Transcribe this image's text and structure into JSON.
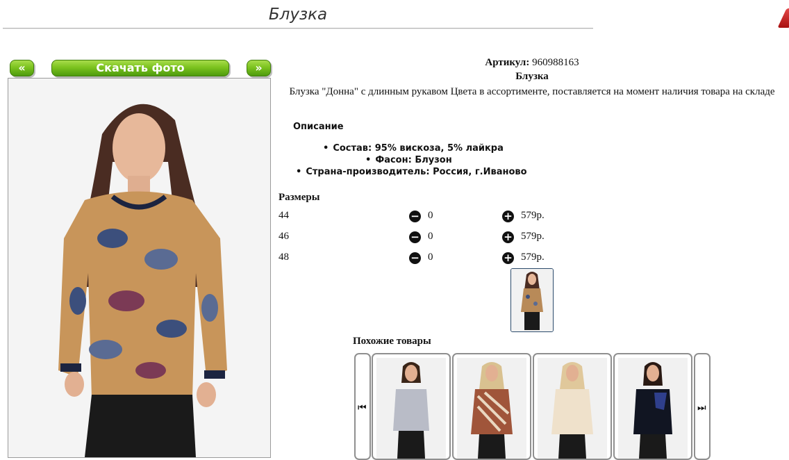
{
  "page": {
    "title": "Блузка"
  },
  "gallery": {
    "prev_label": "«",
    "download_label": "Скачать фото",
    "next_label": "»"
  },
  "product": {
    "article_label": "Артикул:",
    "article_value": "960988163",
    "name": "Блузка",
    "description": "Блузка \"Донна\" с длинным рукавом Цвета в ассортименте, поставляется на момент наличия товара на складе",
    "details_title": "Описание",
    "details": [
      "Состав: 95% вискоза, 5% лайкра",
      "Фасон: Блузон",
      "Страна-производитель: Россия, г.Иваново"
    ]
  },
  "sizes": {
    "title": "Размеры",
    "minus_icon": "−",
    "plus_icon": "+",
    "rows": [
      {
        "size": "44",
        "qty": "0",
        "price": "579р."
      },
      {
        "size": "46",
        "qty": "0",
        "price": "579р."
      },
      {
        "size": "48",
        "qty": "0",
        "price": "579р."
      }
    ]
  },
  "similar": {
    "title": "Похожие товары",
    "prev_icon": "⏮",
    "next_icon": "⏭"
  },
  "colors": {
    "button_green": "#7cc31f",
    "accent_red": "#c81d1d"
  }
}
